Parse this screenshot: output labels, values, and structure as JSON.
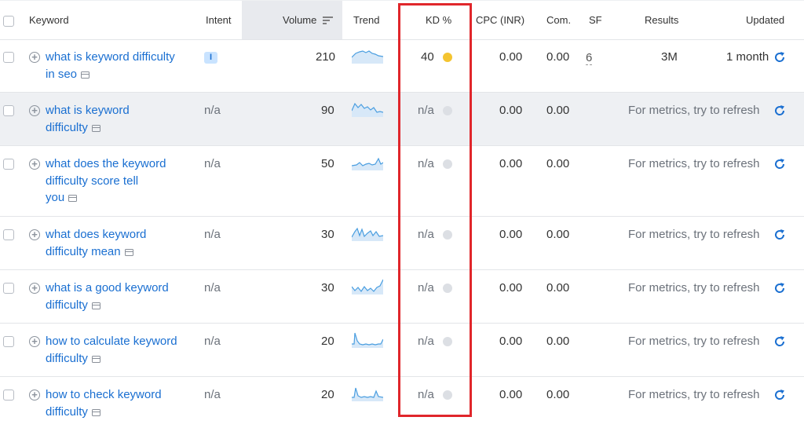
{
  "header": {
    "keyword": "Keyword",
    "intent": "Intent",
    "volume": "Volume",
    "trend": "Trend",
    "kd": "KD %",
    "cpc": "CPC (INR)",
    "com": "Com.",
    "sf": "SF",
    "results": "Results",
    "updated": "Updated"
  },
  "rows": [
    {
      "line1": "what is keyword difficulty",
      "line2": "in seo",
      "line3": "",
      "intent": "I",
      "volume": "210",
      "kd": "40",
      "cpc": "0.00",
      "com": "0.00",
      "sf": "6",
      "results": "3M",
      "updated": "1 month"
    },
    {
      "line1": "what is keyword",
      "line2": "difficulty",
      "line3": "",
      "intent": "n/a",
      "volume": "90",
      "kd": "n/a",
      "cpc": "0.00",
      "com": "0.00",
      "refresh_text": "For metrics, try to refresh"
    },
    {
      "line1": "what does the keyword",
      "line2": "difficulty score tell",
      "line3": "you",
      "intent": "n/a",
      "volume": "50",
      "kd": "n/a",
      "cpc": "0.00",
      "com": "0.00",
      "refresh_text": "For metrics, try to refresh"
    },
    {
      "line1": "what does keyword",
      "line2": "difficulty mean",
      "line3": "",
      "intent": "n/a",
      "volume": "30",
      "kd": "n/a",
      "cpc": "0.00",
      "com": "0.00",
      "refresh_text": "For metrics, try to refresh"
    },
    {
      "line1": "what is a good keyword",
      "line2": "difficulty",
      "line3": "",
      "intent": "n/a",
      "volume": "30",
      "kd": "n/a",
      "cpc": "0.00",
      "com": "0.00",
      "refresh_text": "For metrics, try to refresh"
    },
    {
      "line1": "how to calculate keyword",
      "line2": "difficulty",
      "line3": "",
      "intent": "n/a",
      "volume": "20",
      "kd": "n/a",
      "cpc": "0.00",
      "com": "0.00",
      "refresh_text": "For metrics, try to refresh"
    },
    {
      "line1": "how to check keyword",
      "line2": "difficulty",
      "line3": "",
      "intent": "n/a",
      "volume": "20",
      "kd": "n/a",
      "cpc": "0.00",
      "com": "0.00",
      "refresh_text": "For metrics, try to refresh"
    }
  ],
  "colors": {
    "link": "#1a6fd1",
    "kd_easy": "#f4c430",
    "kd_na": "#dcdfe4",
    "highlight_box": "#e0262b",
    "row_highlight": "#eef0f3"
  }
}
